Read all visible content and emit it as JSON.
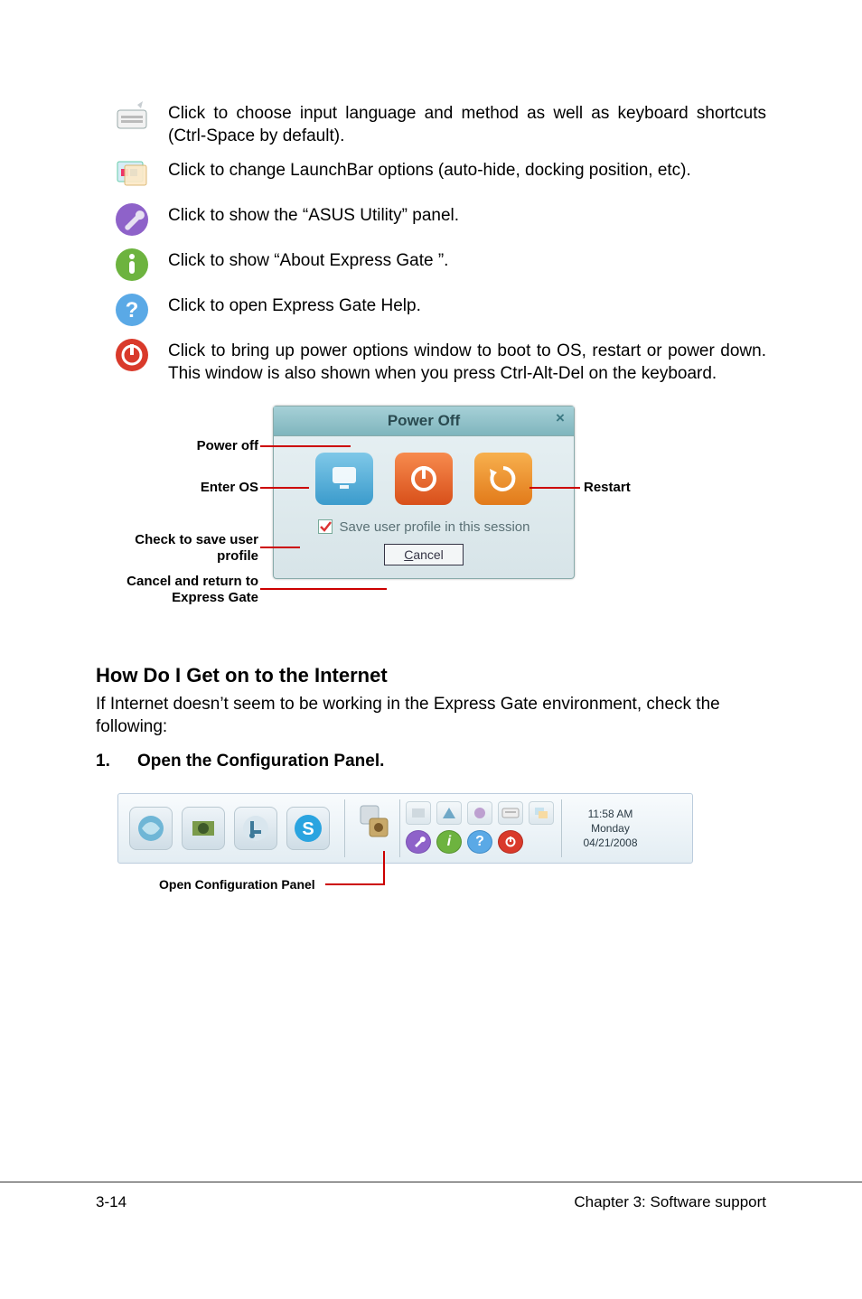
{
  "icons": [
    {
      "name": "keyboard-icon",
      "desc": "Click to choose input language and method as well as keyboard shortcuts (Ctrl-Space by default)."
    },
    {
      "name": "launchbar-options-icon",
      "desc": "Click to change LaunchBar options (auto-hide, docking position, etc)."
    },
    {
      "name": "asus-utility-icon",
      "desc": "Click to show the “ASUS Utility” panel."
    },
    {
      "name": "about-icon",
      "desc": "Click to show “About Express Gate ”."
    },
    {
      "name": "help-icon",
      "desc": "Click to open Express Gate  Help."
    },
    {
      "name": "power-icon",
      "desc": "Click to bring up power options window to boot to OS, restart or power down. This window is also shown when you press Ctrl-Alt-Del on the keyboard."
    }
  ],
  "poweroff": {
    "title": "Power Off",
    "checkbox_label": "Save user profile in this session",
    "cancel": "Cancel",
    "labels": {
      "power_off": "Power off",
      "enter_os": "Enter OS",
      "check_save": "Check to save user profile",
      "cancel_return": "Cancel and return to Express Gate",
      "restart": "Restart"
    }
  },
  "section_heading": "How Do I Get on to the Internet",
  "section_body": "If Internet doesn’t seem to be working in the Express Gate  environment, check the following:",
  "step1_num": "1.",
  "step1_text": "Open the Configuration Panel.",
  "launchbar": {
    "clock_time": "11:58 AM",
    "clock_day": "Monday",
    "clock_date": "04/21/2008",
    "callout": "Open Configuration Panel"
  },
  "footer": {
    "left": "3-14",
    "right": "Chapter 3: Software support"
  }
}
